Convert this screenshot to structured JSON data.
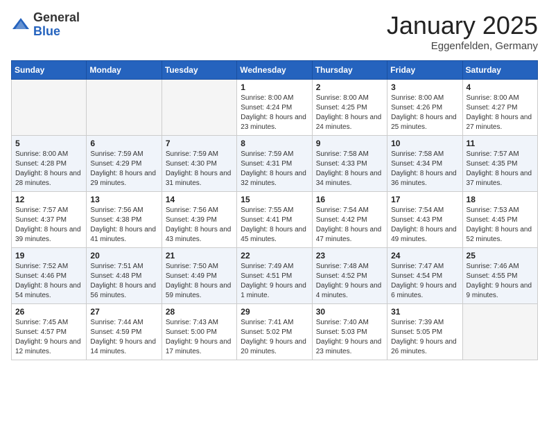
{
  "header": {
    "logo_general": "General",
    "logo_blue": "Blue",
    "title": "January 2025",
    "location": "Eggenfelden, Germany"
  },
  "weekdays": [
    "Sunday",
    "Monday",
    "Tuesday",
    "Wednesday",
    "Thursday",
    "Friday",
    "Saturday"
  ],
  "weeks": [
    [
      {
        "day": "",
        "sunrise": "",
        "sunset": "",
        "daylight": ""
      },
      {
        "day": "",
        "sunrise": "",
        "sunset": "",
        "daylight": ""
      },
      {
        "day": "",
        "sunrise": "",
        "sunset": "",
        "daylight": ""
      },
      {
        "day": "1",
        "sunrise": "Sunrise: 8:00 AM",
        "sunset": "Sunset: 4:24 PM",
        "daylight": "Daylight: 8 hours and 23 minutes."
      },
      {
        "day": "2",
        "sunrise": "Sunrise: 8:00 AM",
        "sunset": "Sunset: 4:25 PM",
        "daylight": "Daylight: 8 hours and 24 minutes."
      },
      {
        "day": "3",
        "sunrise": "Sunrise: 8:00 AM",
        "sunset": "Sunset: 4:26 PM",
        "daylight": "Daylight: 8 hours and 25 minutes."
      },
      {
        "day": "4",
        "sunrise": "Sunrise: 8:00 AM",
        "sunset": "Sunset: 4:27 PM",
        "daylight": "Daylight: 8 hours and 27 minutes."
      }
    ],
    [
      {
        "day": "5",
        "sunrise": "Sunrise: 8:00 AM",
        "sunset": "Sunset: 4:28 PM",
        "daylight": "Daylight: 8 hours and 28 minutes."
      },
      {
        "day": "6",
        "sunrise": "Sunrise: 7:59 AM",
        "sunset": "Sunset: 4:29 PM",
        "daylight": "Daylight: 8 hours and 29 minutes."
      },
      {
        "day": "7",
        "sunrise": "Sunrise: 7:59 AM",
        "sunset": "Sunset: 4:30 PM",
        "daylight": "Daylight: 8 hours and 31 minutes."
      },
      {
        "day": "8",
        "sunrise": "Sunrise: 7:59 AM",
        "sunset": "Sunset: 4:31 PM",
        "daylight": "Daylight: 8 hours and 32 minutes."
      },
      {
        "day": "9",
        "sunrise": "Sunrise: 7:58 AM",
        "sunset": "Sunset: 4:33 PM",
        "daylight": "Daylight: 8 hours and 34 minutes."
      },
      {
        "day": "10",
        "sunrise": "Sunrise: 7:58 AM",
        "sunset": "Sunset: 4:34 PM",
        "daylight": "Daylight: 8 hours and 36 minutes."
      },
      {
        "day": "11",
        "sunrise": "Sunrise: 7:57 AM",
        "sunset": "Sunset: 4:35 PM",
        "daylight": "Daylight: 8 hours and 37 minutes."
      }
    ],
    [
      {
        "day": "12",
        "sunrise": "Sunrise: 7:57 AM",
        "sunset": "Sunset: 4:37 PM",
        "daylight": "Daylight: 8 hours and 39 minutes."
      },
      {
        "day": "13",
        "sunrise": "Sunrise: 7:56 AM",
        "sunset": "Sunset: 4:38 PM",
        "daylight": "Daylight: 8 hours and 41 minutes."
      },
      {
        "day": "14",
        "sunrise": "Sunrise: 7:56 AM",
        "sunset": "Sunset: 4:39 PM",
        "daylight": "Daylight: 8 hours and 43 minutes."
      },
      {
        "day": "15",
        "sunrise": "Sunrise: 7:55 AM",
        "sunset": "Sunset: 4:41 PM",
        "daylight": "Daylight: 8 hours and 45 minutes."
      },
      {
        "day": "16",
        "sunrise": "Sunrise: 7:54 AM",
        "sunset": "Sunset: 4:42 PM",
        "daylight": "Daylight: 8 hours and 47 minutes."
      },
      {
        "day": "17",
        "sunrise": "Sunrise: 7:54 AM",
        "sunset": "Sunset: 4:43 PM",
        "daylight": "Daylight: 8 hours and 49 minutes."
      },
      {
        "day": "18",
        "sunrise": "Sunrise: 7:53 AM",
        "sunset": "Sunset: 4:45 PM",
        "daylight": "Daylight: 8 hours and 52 minutes."
      }
    ],
    [
      {
        "day": "19",
        "sunrise": "Sunrise: 7:52 AM",
        "sunset": "Sunset: 4:46 PM",
        "daylight": "Daylight: 8 hours and 54 minutes."
      },
      {
        "day": "20",
        "sunrise": "Sunrise: 7:51 AM",
        "sunset": "Sunset: 4:48 PM",
        "daylight": "Daylight: 8 hours and 56 minutes."
      },
      {
        "day": "21",
        "sunrise": "Sunrise: 7:50 AM",
        "sunset": "Sunset: 4:49 PM",
        "daylight": "Daylight: 8 hours and 59 minutes."
      },
      {
        "day": "22",
        "sunrise": "Sunrise: 7:49 AM",
        "sunset": "Sunset: 4:51 PM",
        "daylight": "Daylight: 9 hours and 1 minute."
      },
      {
        "day": "23",
        "sunrise": "Sunrise: 7:48 AM",
        "sunset": "Sunset: 4:52 PM",
        "daylight": "Daylight: 9 hours and 4 minutes."
      },
      {
        "day": "24",
        "sunrise": "Sunrise: 7:47 AM",
        "sunset": "Sunset: 4:54 PM",
        "daylight": "Daylight: 9 hours and 6 minutes."
      },
      {
        "day": "25",
        "sunrise": "Sunrise: 7:46 AM",
        "sunset": "Sunset: 4:55 PM",
        "daylight": "Daylight: 9 hours and 9 minutes."
      }
    ],
    [
      {
        "day": "26",
        "sunrise": "Sunrise: 7:45 AM",
        "sunset": "Sunset: 4:57 PM",
        "daylight": "Daylight: 9 hours and 12 minutes."
      },
      {
        "day": "27",
        "sunrise": "Sunrise: 7:44 AM",
        "sunset": "Sunset: 4:59 PM",
        "daylight": "Daylight: 9 hours and 14 minutes."
      },
      {
        "day": "28",
        "sunrise": "Sunrise: 7:43 AM",
        "sunset": "Sunset: 5:00 PM",
        "daylight": "Daylight: 9 hours and 17 minutes."
      },
      {
        "day": "29",
        "sunrise": "Sunrise: 7:41 AM",
        "sunset": "Sunset: 5:02 PM",
        "daylight": "Daylight: 9 hours and 20 minutes."
      },
      {
        "day": "30",
        "sunrise": "Sunrise: 7:40 AM",
        "sunset": "Sunset: 5:03 PM",
        "daylight": "Daylight: 9 hours and 23 minutes."
      },
      {
        "day": "31",
        "sunrise": "Sunrise: 7:39 AM",
        "sunset": "Sunset: 5:05 PM",
        "daylight": "Daylight: 9 hours and 26 minutes."
      },
      {
        "day": "",
        "sunrise": "",
        "sunset": "",
        "daylight": ""
      }
    ]
  ]
}
